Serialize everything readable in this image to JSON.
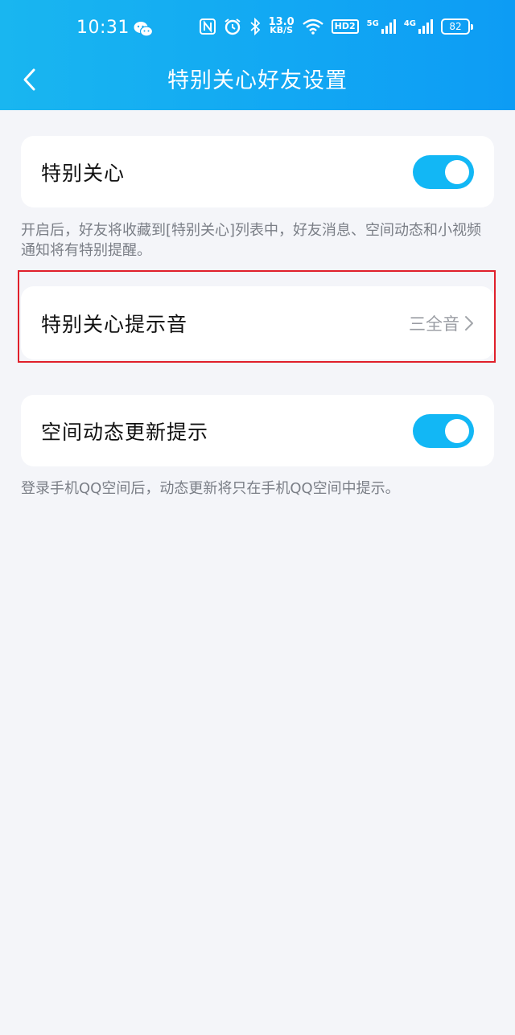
{
  "status_bar": {
    "time": "10:31",
    "net_speed_value": "13.0",
    "net_speed_unit": "KB/S",
    "hd_label": "HD2",
    "net1_label": "5G",
    "net2_label": "4G",
    "battery": "82"
  },
  "header": {
    "title": "特别关心好友设置"
  },
  "settings": {
    "special_care": {
      "label": "特别关心",
      "enabled": true,
      "description": "开启后，好友将收藏到[特别关心]列表中，好友消息、空间动态和小视频通知将有特别提醒。"
    },
    "alert_tone": {
      "label": "特别关心提示音",
      "value": "三全音"
    },
    "qzone_updates": {
      "label": "空间动态更新提示",
      "enabled": true,
      "description": "登录手机QQ空间后，动态更新将只在手机QQ空间中提示。"
    }
  },
  "colors": {
    "header_gradient_start": "#19b6f0",
    "header_gradient_end": "#0d9cf4",
    "toggle_on": "#12b7f5",
    "highlight_border": "#e0202b",
    "background": "#f4f5f9"
  }
}
